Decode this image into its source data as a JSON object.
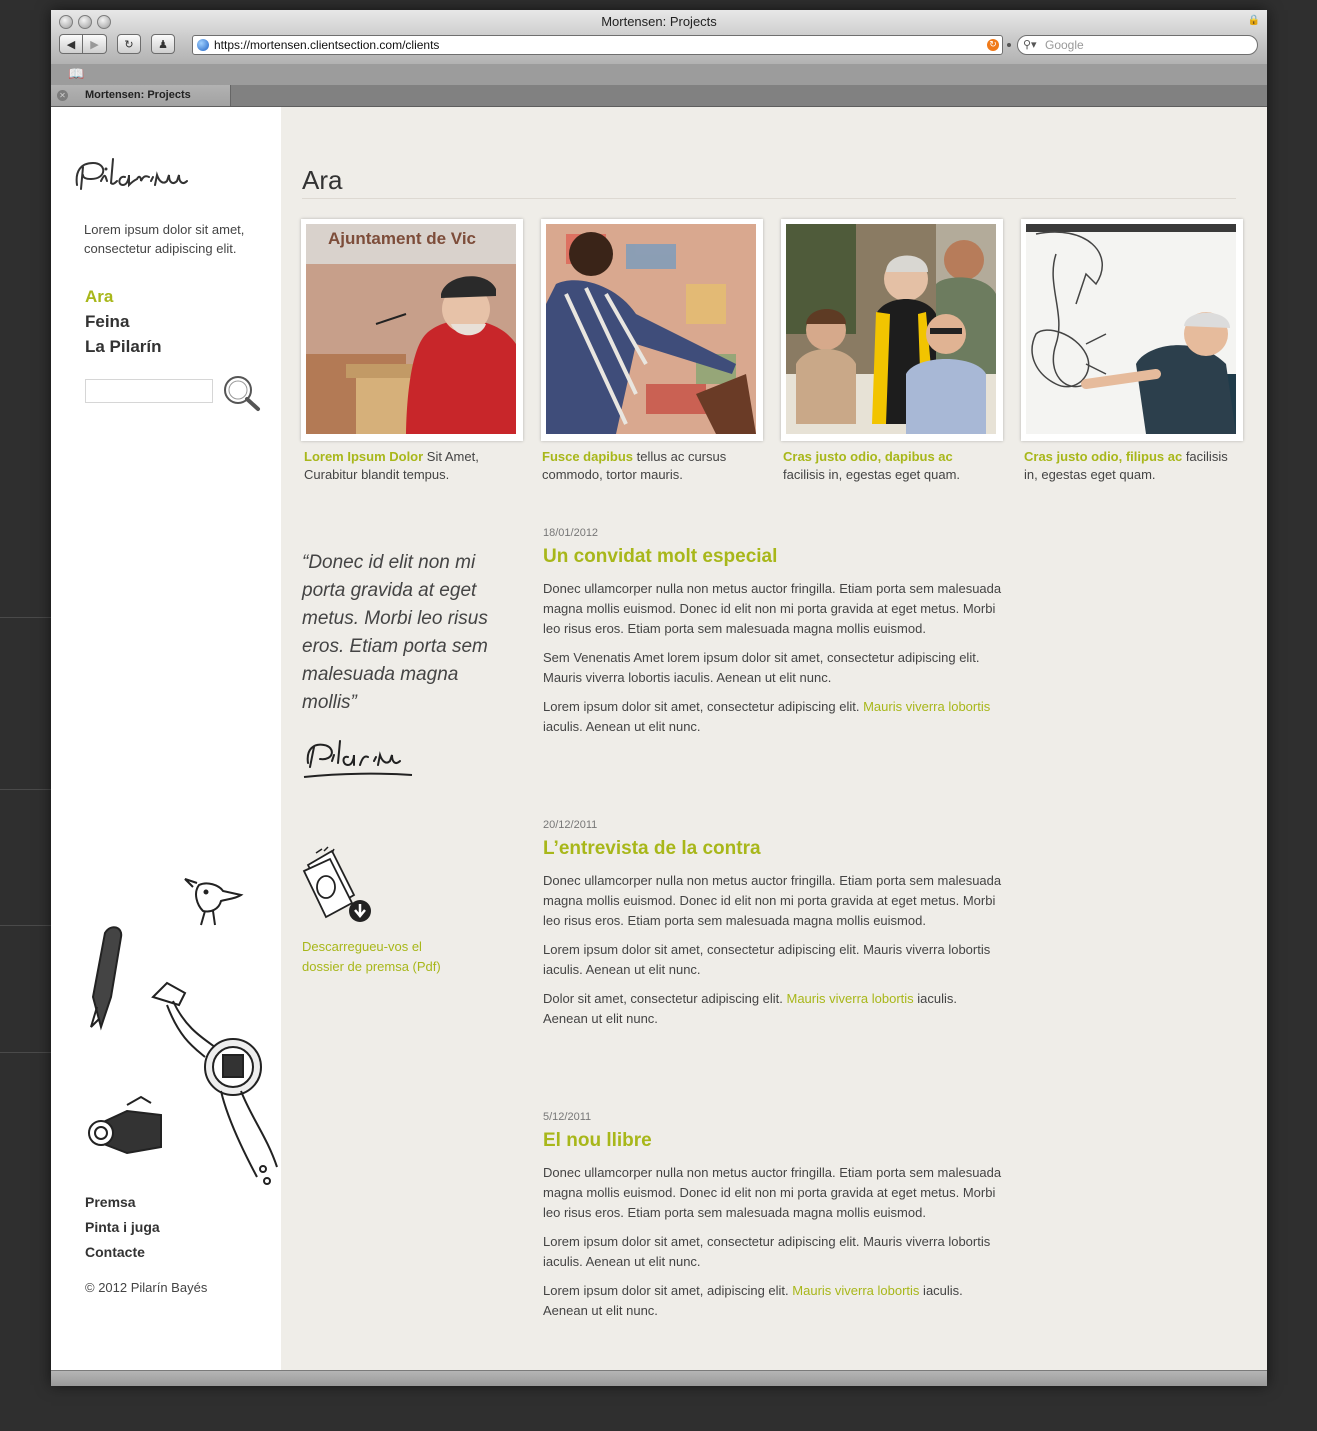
{
  "browser": {
    "window_title": "Mortensen: Projects",
    "url": "https://mortensen.clientsection.com/clients",
    "search_placeholder": "Google",
    "tab_title": "Mortensen: Projects"
  },
  "sidebar": {
    "logo_text": "Pilarín",
    "tagline": "Lorem ipsum dolor sit amet, consectetur adipiscing elit.",
    "nav": [
      "Ara",
      "Feina",
      "La Pilarín"
    ],
    "footer_nav": [
      "Premsa",
      "Pinta i juga",
      "Contacte"
    ],
    "copyright": "© 2012 Pilarín Bayés"
  },
  "main": {
    "page_title": "Ara",
    "gallery": [
      {
        "highlight": "Lorem Ipsum Dolor",
        "text": " Sit Amet, Curabitur blandit tempus.",
        "photo_text": "Ajuntament de Vic"
      },
      {
        "highlight": "Fusce dapibus",
        "text": " tellus ac cursus commodo, tortor mauris."
      },
      {
        "highlight": "Cras justo odio, dapibus ac",
        "text": " facilisis in, egestas eget quam."
      },
      {
        "highlight": "Cras justo odio, filipus ac",
        "text": " facilisis in, egestas eget quam."
      }
    ],
    "quote": "“Donec id elit non mi porta gravida at eget metus. Morbi leo risus eros. Etiam porta sem malesuada magna mollis”",
    "signature": "Pilarín",
    "download_text": "Descarregueu-vos el dossier de premsa (Pdf)",
    "posts": [
      {
        "date": "18/01/2012",
        "title": "Un convidat molt especial",
        "p1": "Donec ullamcorper nulla non metus auctor fringilla. Etiam porta sem malesuada magna mollis euismod. Donec id elit non mi porta gravida at eget metus. Morbi leo risus eros. Etiam porta sem malesuada magna mollis euismod.",
        "p2": "Sem Venenatis Amet lorem ipsum dolor sit amet, consectetur adipiscing elit. Mauris viverra lobortis iaculis. Aenean ut elit nunc.",
        "p3_pre": "Lorem ipsum dolor sit amet, consectetur adipiscing elit. ",
        "p3_link": "Mauris viverra lobortis",
        "p3_post": " iaculis. Aenean ut elit nunc."
      },
      {
        "date": "20/12/2011",
        "title": "L’entrevista de la contra",
        "p1": "Donec ullamcorper nulla non metus auctor fringilla. Etiam porta sem malesuada magna mollis euismod. Donec id elit non mi porta gravida at eget metus. Morbi leo risus eros. Etiam porta sem malesuada magna mollis euismod.",
        "p2": "Lorem ipsum dolor sit amet, consectetur adipiscing elit. Mauris viverra lobortis iaculis. Aenean ut elit nunc.",
        "p3_pre": "Dolor sit amet, consectetur adipiscing elit. ",
        "p3_link": "Mauris viverra lobortis",
        "p3_post": " iaculis. Aenean ut elit nunc."
      },
      {
        "date": "5/12/2011",
        "title": "El nou llibre",
        "p1": "Donec ullamcorper nulla non metus auctor fringilla. Etiam porta sem malesuada magna mollis euismod. Donec id elit non mi porta gravida at eget metus. Morbi leo risus eros. Etiam porta sem malesuada magna mollis euismod.",
        "p2": "Lorem ipsum dolor sit amet, consectetur adipiscing elit. Mauris viverra lobortis iaculis. Aenean ut elit nunc.",
        "p3_pre": "Lorem ipsum dolor sit amet, adipiscing elit. ",
        "p3_link": "Mauris viverra lobortis",
        "p3_post": " iaculis. Aenean ut elit nunc."
      }
    ]
  },
  "colors": {
    "accent": "#a8b71a",
    "text": "#444444",
    "sidebar_bg": "#ffffff",
    "main_bg": "#efede8",
    "desktop": "#2f2f2f"
  },
  "icons": [
    "back-icon",
    "forward-icon",
    "reload-icon",
    "home-icon",
    "lock-icon",
    "globe-icon",
    "rss-icon",
    "search-icon",
    "bookmarks-icon",
    "tab-close-icon",
    "magnifier-icon",
    "book-download-icon"
  ]
}
